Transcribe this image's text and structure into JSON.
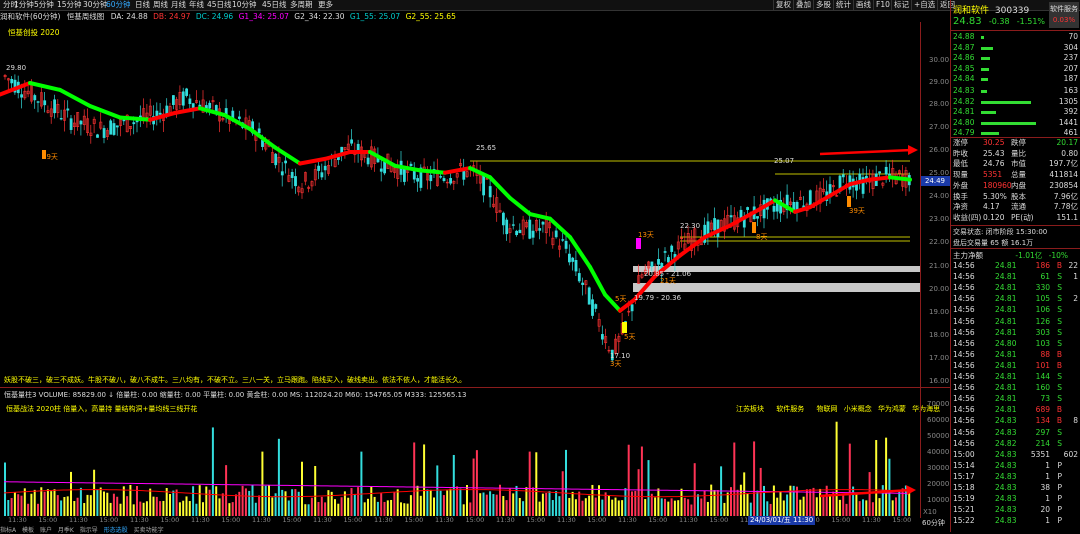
{
  "topbar": {
    "periods": [
      "分时",
      "1分钟",
      "5分钟",
      "15分钟",
      "30分钟",
      "60分钟",
      "日线",
      "周线",
      "月线",
      "年线",
      "45日线",
      "10分钟",
      "45日线",
      "多周期",
      "更多"
    ],
    "active_period": "60分钟",
    "right_buttons": [
      "复权",
      "叠加",
      "多股",
      "统计",
      "画线",
      "F10",
      "标记",
      "+自选",
      "返回"
    ]
  },
  "header": {
    "title": "润和软件(60分钟)",
    "formula": "恒基周线图",
    "da": "DA: 24.88",
    "db": "DB: 24.97",
    "dc": "DC: 24.96",
    "g1": "G1_34: 25.07",
    "g2": "G2_34: 22.30",
    "g1_55": "G1_55: 25.07",
    "g2_55": "G2_55: 25.65",
    "sub": "恒基创投 2020"
  },
  "price_axis": [
    "30.00",
    "29.00",
    "28.00",
    "27.00",
    "26.00",
    "25.00",
    "24.00",
    "23.00",
    "22.00",
    "21.00",
    "20.00",
    "19.00",
    "18.00",
    "17.00",
    "16.00"
  ],
  "annotations": {
    "high_left": "29.80",
    "mid_high": "25.65",
    "right_high": "25.07",
    "level_2230": "22.30",
    "low": "17.10",
    "zone_a": "20.85 - 21.06",
    "zone_b": "19.79 - 20.36",
    "days_89a": "89天",
    "days_89b": "89天",
    "days_13a": "13天",
    "days_13b": "13天",
    "days_21": "21天",
    "days_5a": "5天",
    "days_5b": "5天",
    "days_8": "8天",
    "days_3": "3天",
    "days_39": "39天",
    "current_price_tag": "24.49",
    "slogan": "妖股不破三，破三不成妖。牛股不破八，破八不成牛。三八均有，不破不立。三八一关，立马跟跑。陷线买入，破线卖出。依法不依人，才能活长久。"
  },
  "volume": {
    "header": "恒基量柱3 VOLUME: 85829.00 ↓ 倍量柱: 0.00 缩量柱: 0.00 平量柱: 0.00 黄金柱: 0.00 MS: 112024.20 M60: 154765.05 M333: 125565.13",
    "sub": "恒基战法 2020柱 倍量入，高量持 量结构洞+量均线三线开花",
    "tags": [
      "江苏板块",
      "软件服务",
      "物联网",
      "小米概念",
      "华为鸿蒙",
      "华为海思"
    ],
    "axis": [
      "70000",
      "60000",
      "50000",
      "40000",
      "30000",
      "20000",
      "10000"
    ],
    "unit": "X10",
    "date_tag": "24/03/01/五 11:30",
    "period_tag": "60分钟"
  },
  "time_axis": [
    "11:30",
    "15:00",
    "11:30",
    "15:00",
    "11:30",
    "15:00",
    "11:30",
    "15:00",
    "11:30",
    "15:00",
    "11:30",
    "15:00",
    "11:30",
    "15:00",
    "11:30",
    "15:00",
    "11:30",
    "15:00",
    "11:30",
    "15:00",
    "11:30",
    "15:00",
    "11:30",
    "15:00",
    "11:30",
    "15:00",
    "11:30",
    "15:00",
    "11:30",
    "15:00"
  ],
  "bottom_tabs": [
    "指标A",
    "模板",
    "账户",
    "月季K",
    "指示导",
    "形态选股",
    "买卖功能字"
  ],
  "side": {
    "name": "润和软件",
    "code": "300339",
    "badge": "软件服务",
    "badge_pct": "0.03%",
    "price": "24.83",
    "change": "-0.38",
    "change_pct": "-1.51%",
    "asks": [
      {
        "p": "24.88",
        "v": "70"
      },
      {
        "p": "24.87",
        "v": "304"
      },
      {
        "p": "24.86",
        "v": "237"
      },
      {
        "p": "24.85",
        "v": "207"
      },
      {
        "p": "24.84",
        "v": "187"
      }
    ],
    "bids": [
      {
        "p": "24.83",
        "v": "163"
      },
      {
        "p": "24.82",
        "v": "1305"
      },
      {
        "p": "24.81",
        "v": "392"
      },
      {
        "p": "24.80",
        "v": "1441"
      },
      {
        "p": "24.79",
        "v": "461"
      }
    ],
    "stats": [
      {
        "l1": "涨停",
        "v1": "30.25",
        "l2": "跌停",
        "v2": "20.17"
      },
      {
        "l1": "昨收",
        "v1": "25.43",
        "l2": "量比",
        "v2": "0.80"
      },
      {
        "l1": "最低",
        "v1": "24.76",
        "l2": "市值",
        "v2": "197.7亿"
      },
      {
        "l1": "现量",
        "v1": "5351",
        "l2": "总量",
        "v2": "411814"
      },
      {
        "l1": "外盘",
        "v1": "180960",
        "l2": "内盘",
        "v2": "230854"
      },
      {
        "l1": "换手",
        "v1": "5.30%",
        "l2": "股本",
        "v2": "7.96亿"
      },
      {
        "l1": "净资",
        "v1": "4.17",
        "l2": "流通",
        "v2": "7.78亿"
      },
      {
        "l1": "收益(四)",
        "v1": "0.120",
        "l2": "PE(动)",
        "v2": "151.1"
      }
    ],
    "trade_status": "交易状态: 闭市阶段 15:30:00",
    "after_hours": "盘后交易量 65 额 16.1万",
    "flow_label": "主力净额",
    "flow_a": "-1.01亿",
    "flow_b": "-10%",
    "ticks": [
      {
        "t": "14:56",
        "p": "24.81",
        "v": "186",
        "d": "B"
      },
      {
        "t": "14:56",
        "p": "24.81",
        "v": "61",
        "d": "S"
      },
      {
        "t": "14:56",
        "p": "24.81",
        "v": "330",
        "d": "S"
      },
      {
        "t": "14:56",
        "p": "24.81",
        "v": "105",
        "d": "S"
      },
      {
        "t": "14:56",
        "p": "24.81",
        "v": "106",
        "d": "S"
      },
      {
        "t": "14:56",
        "p": "24.81",
        "v": "126",
        "d": "S"
      },
      {
        "t": "14:56",
        "p": "24.81",
        "v": "303",
        "d": "S"
      },
      {
        "t": "14:56",
        "p": "24.80",
        "v": "103",
        "d": "S"
      },
      {
        "t": "14:56",
        "p": "24.81",
        "v": "88",
        "d": "B"
      },
      {
        "t": "14:56",
        "p": "24.81",
        "v": "101",
        "d": "B"
      },
      {
        "t": "14:56",
        "p": "24.81",
        "v": "144",
        "d": "S"
      },
      {
        "t": "14:56",
        "p": "24.81",
        "v": "160",
        "d": "S"
      },
      {
        "t": "14:56",
        "p": "24.81",
        "v": "73",
        "d": "S"
      },
      {
        "t": "14:56",
        "p": "24.81",
        "v": "689",
        "d": "B"
      },
      {
        "t": "14:56",
        "p": "24.83",
        "v": "134",
        "d": "B"
      },
      {
        "t": "14:56",
        "p": "24.83",
        "v": "297",
        "d": "S"
      },
      {
        "t": "14:56",
        "p": "24.82",
        "v": "214",
        "d": "S"
      },
      {
        "t": "15:00",
        "p": "24.83",
        "v": "5351",
        "d": ""
      },
      {
        "t": "15:14",
        "p": "24.83",
        "v": "1",
        "d": "P"
      },
      {
        "t": "15:17",
        "p": "24.83",
        "v": "1",
        "d": "P"
      },
      {
        "t": "15:18",
        "p": "24.83",
        "v": "38",
        "d": "P"
      },
      {
        "t": "15:19",
        "p": "24.83",
        "v": "1",
        "d": "P"
      },
      {
        "t": "15:21",
        "p": "24.83",
        "v": "20",
        "d": "P"
      },
      {
        "t": "15:22",
        "p": "24.83",
        "v": "1",
        "d": "P"
      }
    ],
    "tick_extra": [
      "22",
      "1",
      "",
      "2",
      "",
      "",
      "",
      "",
      "",
      "",
      "",
      "",
      "",
      "",
      "8",
      "",
      "",
      "602",
      "",
      "",
      "",
      "",
      "",
      ""
    ],
    "colors": {
      "up": "#ff3333",
      "down": "#33dd33",
      "ma_red": "#ff0000",
      "ma_green": "#00ff00"
    }
  }
}
